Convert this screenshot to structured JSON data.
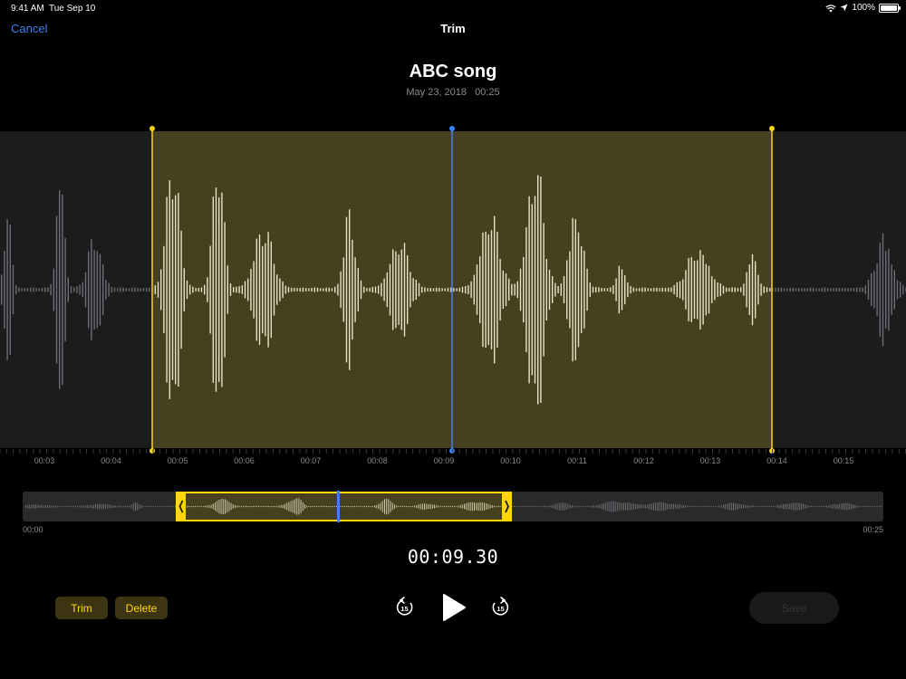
{
  "status_bar": {
    "time": "9:41 AM",
    "date": "Tue Sep 10",
    "battery": "100%"
  },
  "nav": {
    "cancel_label": "Cancel",
    "title": "Trim"
  },
  "recording": {
    "title": "ABC song",
    "date": "May 23, 2018",
    "duration": "00:25"
  },
  "timeline": {
    "ticks": [
      "00:03",
      "00:04",
      "00:05",
      "00:06",
      "00:07",
      "00:08",
      "00:09",
      "00:10",
      "00:11",
      "00:12",
      "00:13",
      "00:14",
      "00:15"
    ]
  },
  "overview": {
    "start_label": "00:00",
    "end_label": "00:25"
  },
  "counter": "00:09.30",
  "buttons": {
    "trim": "Trim",
    "delete": "Delete",
    "save": "Save"
  },
  "playback": {
    "skip_back_label": "15",
    "skip_forward_label": "15"
  },
  "colors": {
    "accent": "#ffd60a",
    "playhead": "#3b82f6",
    "selection": "#46401f",
    "link": "#3b82f6"
  }
}
